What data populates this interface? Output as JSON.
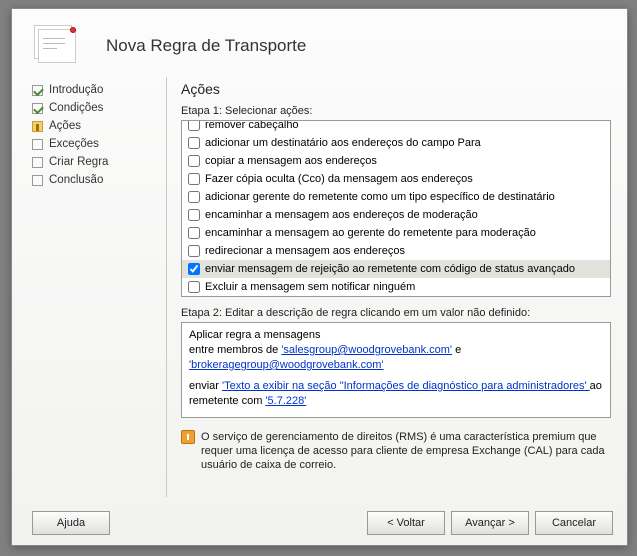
{
  "header": {
    "title": "Nova Regra de Transporte"
  },
  "sidebar": {
    "items": [
      {
        "label": "Introdução",
        "state": "completed"
      },
      {
        "label": "Condições",
        "state": "completed"
      },
      {
        "label": "Ações",
        "state": "current"
      },
      {
        "label": "Exceções",
        "state": "pending"
      },
      {
        "label": "Criar Regra",
        "state": "pending"
      },
      {
        "label": "Conclusão",
        "state": "pending"
      }
    ]
  },
  "main": {
    "heading": "Ações",
    "step1_label": "Etapa 1: Selecionar ações:",
    "actions": [
      {
        "label": "remover cabeçalho",
        "checked": false
      },
      {
        "label": "adicionar um destinatário aos endereços do campo Para",
        "checked": false
      },
      {
        "label": "copiar a mensagem aos endereços",
        "checked": false
      },
      {
        "label": "Fazer cópia oculta (Cco) da mensagem aos endereços",
        "checked": false
      },
      {
        "label": "adicionar gerente do remetente como um tipo específico de destinatário",
        "checked": false
      },
      {
        "label": "encaminhar a mensagem aos endereços de moderação",
        "checked": false
      },
      {
        "label": "encaminhar a mensagem ao gerente do remetente para moderação",
        "checked": false
      },
      {
        "label": "redirecionar a mensagem aos endereços",
        "checked": false
      },
      {
        "label": "enviar mensagem de rejeição ao remetente com código de status avançado",
        "checked": true,
        "selected": true
      },
      {
        "label": "Excluir a mensagem sem notificar ninguém",
        "checked": false
      }
    ],
    "step2_label": "Etapa 2: Editar a descrição de regra clicando em um valor não definido:",
    "rule_desc": {
      "line1": "Aplicar regra a mensagens",
      "line2_pre": "entre membros de ",
      "link1": "'salesgroup@woodgrovebank.com'",
      "line2_mid": " e ",
      "link2": "'brokeragegroup@woodgrovebank.com'",
      "line3_pre": "enviar ",
      "link3": " 'Texto a exibir na seção \"Informações de diagnóstico para administradores' ",
      "line3_post": " ao remetente com ",
      "link4": "'5.7.228'"
    },
    "info_text": "O serviço de gerenciamento de direitos (RMS) é uma característica premium que requer uma licença de acesso para cliente de empresa Exchange (CAL) para cada usuário de caixa de correio."
  },
  "footer": {
    "help": "Ajuda",
    "back": "< Voltar",
    "next": "Avançar >",
    "cancel": "Cancelar"
  }
}
